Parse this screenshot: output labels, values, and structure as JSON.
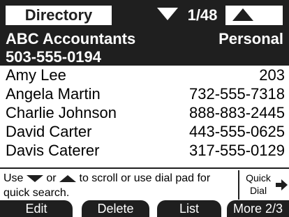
{
  "header": {
    "title": "Directory",
    "count": "1/48"
  },
  "selected": {
    "name": "ABC Accountants",
    "type": "Personal",
    "number": "503-555-0194"
  },
  "entries": [
    {
      "name": "Amy Lee",
      "number": "203"
    },
    {
      "name": "Angela Martin",
      "number": "732-555-7318"
    },
    {
      "name": "Charlie Johnson",
      "number": "888-883-2445"
    },
    {
      "name": "David Carter",
      "number": "443-555-0625"
    },
    {
      "name": "Davis Caterer",
      "number": "317-555-0129"
    }
  ],
  "help": {
    "text_use": "Use",
    "text_or": "or",
    "text_rest": "to scroll or use dial pad for quick search.",
    "quick_dial": "Quick Dial"
  },
  "softkeys": {
    "edit": "Edit",
    "delete": "Delete",
    "list": "List",
    "more": "More 2/3"
  },
  "icons": {
    "scroll_down": "down-triangle-icon",
    "scroll_up": "up-triangle-icon",
    "quick_dial": "right-arrow-icon"
  },
  "colors": {
    "dark": "#1f1f1f",
    "light": "#ffffff"
  }
}
